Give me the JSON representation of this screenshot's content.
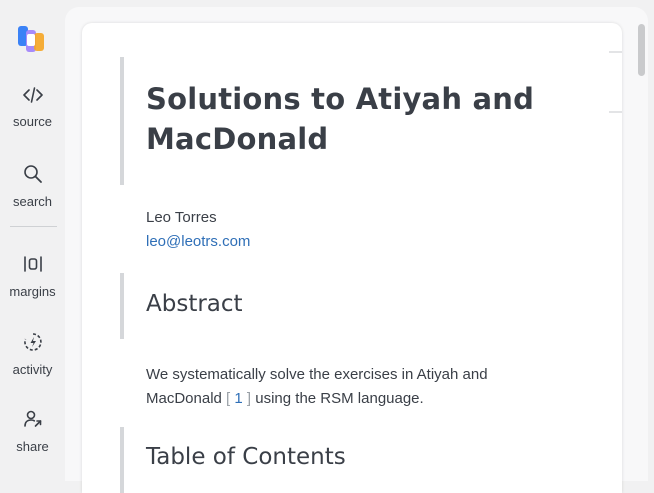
{
  "sidebar": {
    "logo_icon": "app-logo",
    "items": [
      {
        "label": "source",
        "icon": "code-icon"
      },
      {
        "label": "search",
        "icon": "search-icon"
      },
      {
        "label": "margins",
        "icon": "margins-icon"
      },
      {
        "label": "activity",
        "icon": "activity-icon"
      },
      {
        "label": "share",
        "icon": "share-icon"
      }
    ]
  },
  "document": {
    "title": "Solutions to Atiyah and MacDonald",
    "author": "Leo Torres",
    "email": "leo@leotrs.com",
    "abstract_heading": "Abstract",
    "abstract_text_before": "We systematically solve the exercises in Atiyah and MacDonald",
    "citation_open": "[",
    "citation_number": "1",
    "citation_close": "]",
    "abstract_text_after": "using the RSM language.",
    "toc_heading": "Table of Contents"
  },
  "colors": {
    "link": "#2f6fb7",
    "text": "#3a3f47",
    "background": "#f1f1f2",
    "card": "#ffffff"
  }
}
